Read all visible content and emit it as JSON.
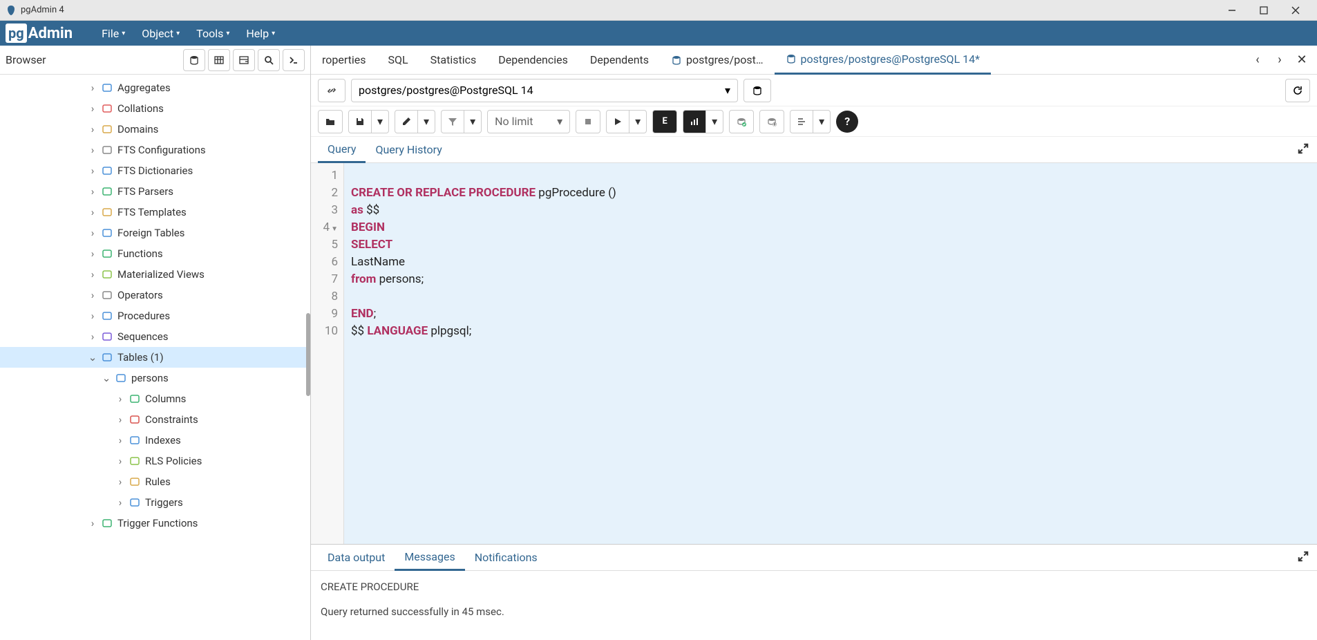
{
  "window": {
    "title": "pgAdmin 4"
  },
  "menu": {
    "file": "File",
    "object": "Object",
    "tools": "Tools",
    "help": "Help"
  },
  "logo": {
    "pg": "pg",
    "admin": "Admin"
  },
  "browser": {
    "title": "Browser",
    "nodes": [
      {
        "label": "Aggregates",
        "icon": "aggregates",
        "color": "#4a90d9"
      },
      {
        "label": "Collations",
        "icon": "collations",
        "color": "#e05c5c"
      },
      {
        "label": "Domains",
        "icon": "domains",
        "color": "#d9a94a"
      },
      {
        "label": "FTS Configurations",
        "icon": "fts-config",
        "color": "#888"
      },
      {
        "label": "FTS Dictionaries",
        "icon": "fts-dict",
        "color": "#4a90d9"
      },
      {
        "label": "FTS Parsers",
        "icon": "fts-parser",
        "color": "#3cb371"
      },
      {
        "label": "FTS Templates",
        "icon": "fts-template",
        "color": "#d9a94a"
      },
      {
        "label": "Foreign Tables",
        "icon": "foreign-tables",
        "color": "#4a90d9"
      },
      {
        "label": "Functions",
        "icon": "functions",
        "color": "#3cb371"
      },
      {
        "label": "Materialized Views",
        "icon": "mat-views",
        "color": "#8bc34a"
      },
      {
        "label": "Operators",
        "icon": "operators",
        "color": "#888"
      },
      {
        "label": "Procedures",
        "icon": "procedures",
        "color": "#4a90d9"
      },
      {
        "label": "Sequences",
        "icon": "sequences",
        "color": "#7b5cd9"
      },
      {
        "label": "Tables (1)",
        "icon": "tables",
        "color": "#4a90d9",
        "expanded": true,
        "selected": true
      },
      {
        "label": "Trigger Functions",
        "icon": "trigger-functions",
        "color": "#3cb371"
      }
    ],
    "table_children": [
      {
        "label": "persons",
        "icon": "table",
        "color": "#4a90d9",
        "expanded": true
      }
    ],
    "persons_children": [
      {
        "label": "Columns",
        "icon": "columns",
        "color": "#3cb371"
      },
      {
        "label": "Constraints",
        "icon": "constraints",
        "color": "#d9534f"
      },
      {
        "label": "Indexes",
        "icon": "indexes",
        "color": "#4a90d9"
      },
      {
        "label": "RLS Policies",
        "icon": "rls",
        "color": "#8bc34a"
      },
      {
        "label": "Rules",
        "icon": "rules",
        "color": "#d9a94a"
      },
      {
        "label": "Triggers",
        "icon": "triggers",
        "color": "#4a90d9"
      }
    ]
  },
  "tabs": {
    "properties": "roperties",
    "sql": "SQL",
    "statistics": "Statistics",
    "dependencies": "Dependencies",
    "dependents": "Dependents",
    "query1": "postgres/post…",
    "query2": "postgres/postgres@PostgreSQL 14*"
  },
  "connection": {
    "value": "postgres/postgres@PostgreSQL 14"
  },
  "toolbar": {
    "nolimit": "No limit"
  },
  "inner_tabs": {
    "query": "Query",
    "history": "Query History"
  },
  "code": {
    "lines": [
      "",
      "CREATE OR REPLACE PROCEDURE pgProcedure ()",
      "as $$",
      "BEGIN",
      "SELECT",
      "LastName",
      "from persons;",
      "",
      "END;",
      "$$ LANGUAGE plpgsql;"
    ]
  },
  "output": {
    "tabs": {
      "data": "Data output",
      "messages": "Messages",
      "notifications": "Notifications"
    },
    "msg1": "CREATE PROCEDURE",
    "msg2": "Query returned successfully in 45 msec."
  }
}
